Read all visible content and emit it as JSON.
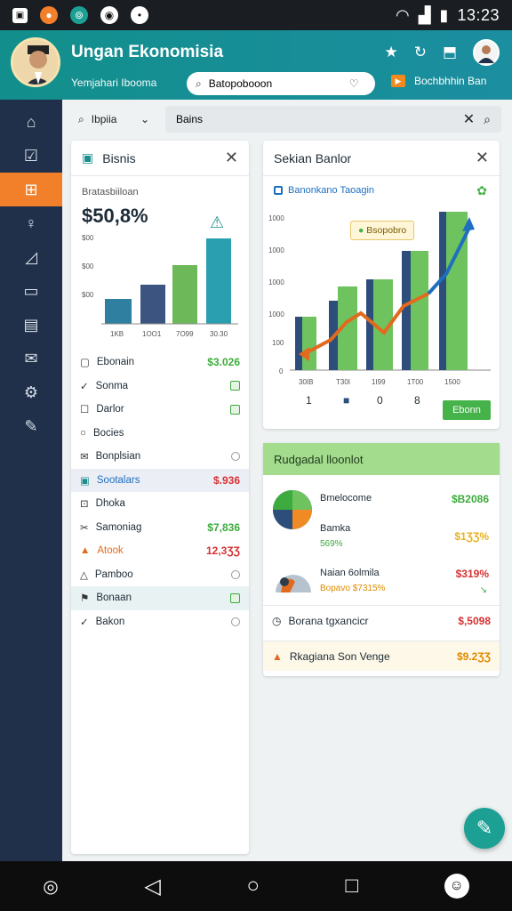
{
  "status_bar": {
    "time": "13:23"
  },
  "header": {
    "title": "Ungan Ekonomisia",
    "subtitle": "Yemjahari Ibooma",
    "search_value": "Batopobooon",
    "link_label": "Bochbhhin Ban"
  },
  "filter": {
    "select_value": "Ibpiia",
    "input_value": "Bains"
  },
  "left_panel": {
    "title": "Bisnis",
    "mini_label": "Bratasbiiloan",
    "big_value": "$50,8%",
    "chart": {
      "y_ticks": [
        "$00",
        "$00",
        "$00"
      ],
      "categories": [
        "1KB",
        "1OO1",
        "7O99",
        "30.30"
      ],
      "colors": [
        "#2e7fa0",
        "#3b5580",
        "#6db858",
        "#2a9fb0"
      ]
    },
    "rows": [
      {
        "label": "Ebonain",
        "value": "$3.026",
        "value_color": "#3cab3c"
      },
      {
        "label": "Sonma",
        "value": "",
        "value_color": "#3cab3c"
      },
      {
        "label": "Darlor",
        "value": "",
        "value_color": "#3cab3c"
      },
      {
        "label": "Bocies",
        "value": "",
        "value_color": "#3cab3c"
      },
      {
        "label": "Bonplsian",
        "value": "",
        "value_color": "#3cab3c"
      },
      {
        "label": "Sootalars",
        "value": "$.936",
        "value_color": "#d63232"
      },
      {
        "label": "Dhoka",
        "value": "",
        "value_color": "#3cab3c"
      },
      {
        "label": "Samoniag",
        "value": "$7,836",
        "value_color": "#3cab3c"
      },
      {
        "label": "Atook",
        "value": "12,3ƷƷ",
        "value_color": "#d63232"
      },
      {
        "label": "Pamboo",
        "value": "",
        "value_color": "#3cab3c"
      },
      {
        "label": "Bonaan",
        "value": "",
        "value_color": "#3cab3c"
      },
      {
        "label": "Bakon",
        "value": "",
        "value_color": "#3cab3c"
      }
    ]
  },
  "right_panel": {
    "title": "Sekian Banlor",
    "legend": "Banonkano Taoagin",
    "callout": "Bsopobro",
    "chart_data": {
      "type": "bar",
      "categories": [
        "30IB",
        "T30I",
        "1I99",
        "1T00",
        "1500"
      ],
      "y_ticks": [
        "1000",
        "1000",
        "1000",
        "1000",
        "100",
        "0"
      ]
    },
    "pager": {
      "first": "1",
      "page": "0",
      "last": "8",
      "button": "Ebonn"
    }
  },
  "bottom_panel": {
    "title": "Rudgadal lloonlot",
    "rows": [
      {
        "label": "Bmelocome",
        "sub": "",
        "value": "$B2086"
      },
      {
        "label": "Bamka",
        "sub": "569%",
        "value": "$1ƷƷ%"
      },
      {
        "label": "Naian 6olmila",
        "sub": "Bopavo $7315%",
        "value": "$319%"
      }
    ],
    "footer_1": {
      "label": "Borana tgxancicr",
      "value": "$,5098"
    },
    "footer_2": {
      "label": "Rkagiana Son Venge",
      "value": "$9.2ƷƷ"
    }
  },
  "sidebar_items": [
    "home",
    "edit",
    "shop",
    "search",
    "chart",
    "calendar",
    "docs",
    "mail",
    "settings",
    "tools"
  ]
}
